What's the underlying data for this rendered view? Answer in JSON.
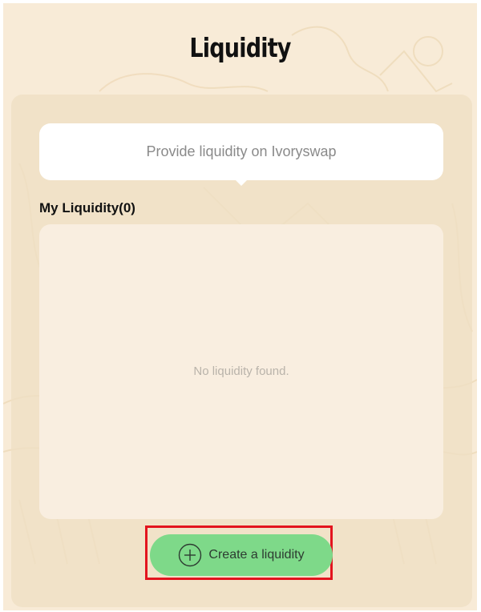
{
  "page": {
    "title": "Liquidity"
  },
  "info": {
    "text": "Provide liquidity on Ivoryswap"
  },
  "my_liquidity": {
    "label": "My Liquidity(0)",
    "empty_text": "No liquidity found."
  },
  "actions": {
    "create_label": "Create a liquidity",
    "create_icon": "plus-circle-icon"
  },
  "colors": {
    "page_background": "#f8ebd7",
    "panel": "#eedfc4",
    "list_background": "#f9eee0",
    "button": "#7ed989",
    "highlight_border": "#e3141e"
  }
}
